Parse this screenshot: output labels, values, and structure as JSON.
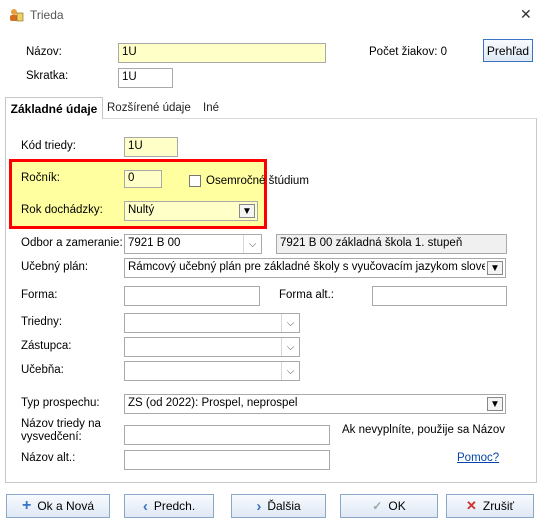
{
  "window": {
    "title": "Trieda",
    "close": "✕"
  },
  "header": {
    "nazov_label": "Názov:",
    "nazov_value": "1U",
    "skratka_label": "Skratka:",
    "skratka_value": "1U",
    "pocet_ziakov": "Počet žiakov: 0",
    "prehlad_button": "Prehľad"
  },
  "tabs": [
    {
      "label": "Základné údaje",
      "active": true
    },
    {
      "label": "Rozšírené údaje",
      "active": false
    },
    {
      "label": "Iné",
      "active": false
    }
  ],
  "form": {
    "kod_triedy_label": "Kód triedy:",
    "kod_triedy_value": "1U",
    "rocnik_label": "Ročník:",
    "rocnik_value": "0",
    "osemrocne_label": "Osemročné štúdium",
    "osemrocne_checked": false,
    "rok_dochadzky_label": "Rok dochádzky:",
    "rok_dochadzky_value": "Nultý",
    "odbor_label": "Odbor a zameranie:",
    "odbor_value": "7921 B 00",
    "odbor_desc": "7921 B 00 základná škola 1. stupeň",
    "ucebny_plan_label": "Učebný plán:",
    "ucebny_plan_value": "Rámcový učebný plán pre základné školy s vyučovacím jazykom slovenským",
    "forma_label": "Forma:",
    "forma_value": "",
    "forma_alt_label": "Forma alt.:",
    "forma_alt_value": "",
    "triedny_label": "Triedny:",
    "triedny_value": "",
    "zastupca_label": "Zástupca:",
    "zastupca_value": "",
    "ucebna_label": "Učebňa:",
    "ucebna_value": "",
    "typ_prospechu_label": "Typ prospechu:",
    "typ_prospechu_value": "ZŠ (od 2022): Prospel, neprospel",
    "nazov_vysvedcenie_label1": "Názov triedy na",
    "nazov_vysvedcenie_label2": "vysvedčení:",
    "nazov_vysvedcenie_value": "",
    "nazov_vysvedcenie_hint": "Ak nevyplníte, použije sa Názov",
    "nazov_alt_label": "Názov alt.:",
    "nazov_alt_value": "",
    "pomoc_link": "Pomoc?"
  },
  "footer": {
    "ok_nova": "Ok a Nová",
    "predch": "Predch.",
    "dalsia": "Ďalšia",
    "ok": "OK",
    "zrusit": "Zrušiť"
  },
  "colors": {
    "highlight_border": "#ff0000",
    "highlight_fill": "#ffffa0",
    "link": "#0645ad"
  }
}
